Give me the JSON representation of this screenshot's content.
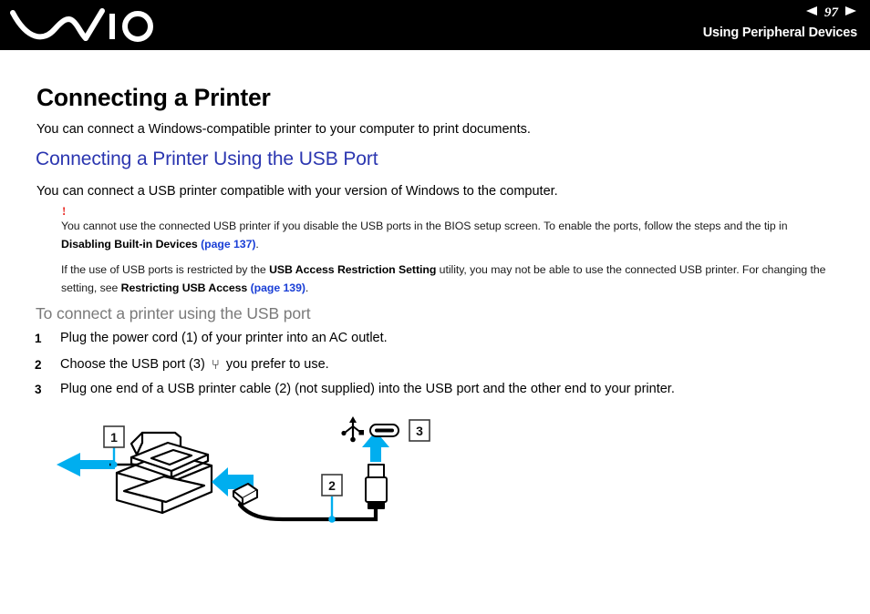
{
  "header": {
    "logo_name": "vaio-logo",
    "page_number": "97",
    "prev_arrow": "◀",
    "next_arrow": "▶",
    "breadcrumb": "Using Peripheral Devices"
  },
  "main": {
    "title": "Connecting a Printer",
    "intro": "You can connect a Windows-compatible printer to your computer to print documents.",
    "section_title": "Connecting a Printer Using the USB Port",
    "section_intro": "You can connect a USB printer compatible with your version of Windows to the computer.",
    "note": {
      "marker": "!",
      "para1_a": "You cannot use the connected USB printer if you disable the USB ports in the BIOS setup screen. To enable the ports, follow the steps and the tip in ",
      "para1_bold": "Disabling Built-in Devices",
      "para1_link": "(page 137)",
      "para1_end": ".",
      "para2_a": "If the use of USB ports is restricted by the ",
      "para2_bold1": "USB Access Restriction Setting",
      "para2_b": " utility, you may not be able to use the connected USB printer. For changing the setting, see ",
      "para2_bold2": "Restricting USB Access",
      "para2_link": "(page 139)",
      "para2_end": "."
    },
    "procedure_title": "To connect a printer using the USB port",
    "steps": [
      {
        "num": "1",
        "text": "Plug the power cord (1) of your printer into an AC outlet."
      },
      {
        "num": "2",
        "text_before": "Choose the USB port (3) ",
        "usb_symbol": "⑂",
        "text_after": " you prefer to use."
      },
      {
        "num": "3",
        "text": "Plug one end of a USB printer cable (2) (not supplied) into the USB port and the other end to your printer."
      }
    ]
  },
  "figure": {
    "name": "printer-usb-connection-diagram",
    "callouts": [
      {
        "label": "1",
        "meaning": "power-cord"
      },
      {
        "label": "2",
        "meaning": "usb-printer-cable"
      },
      {
        "label": "3",
        "meaning": "usb-port"
      }
    ],
    "accent_color": "#00AEEF",
    "line_color": "#000000"
  }
}
